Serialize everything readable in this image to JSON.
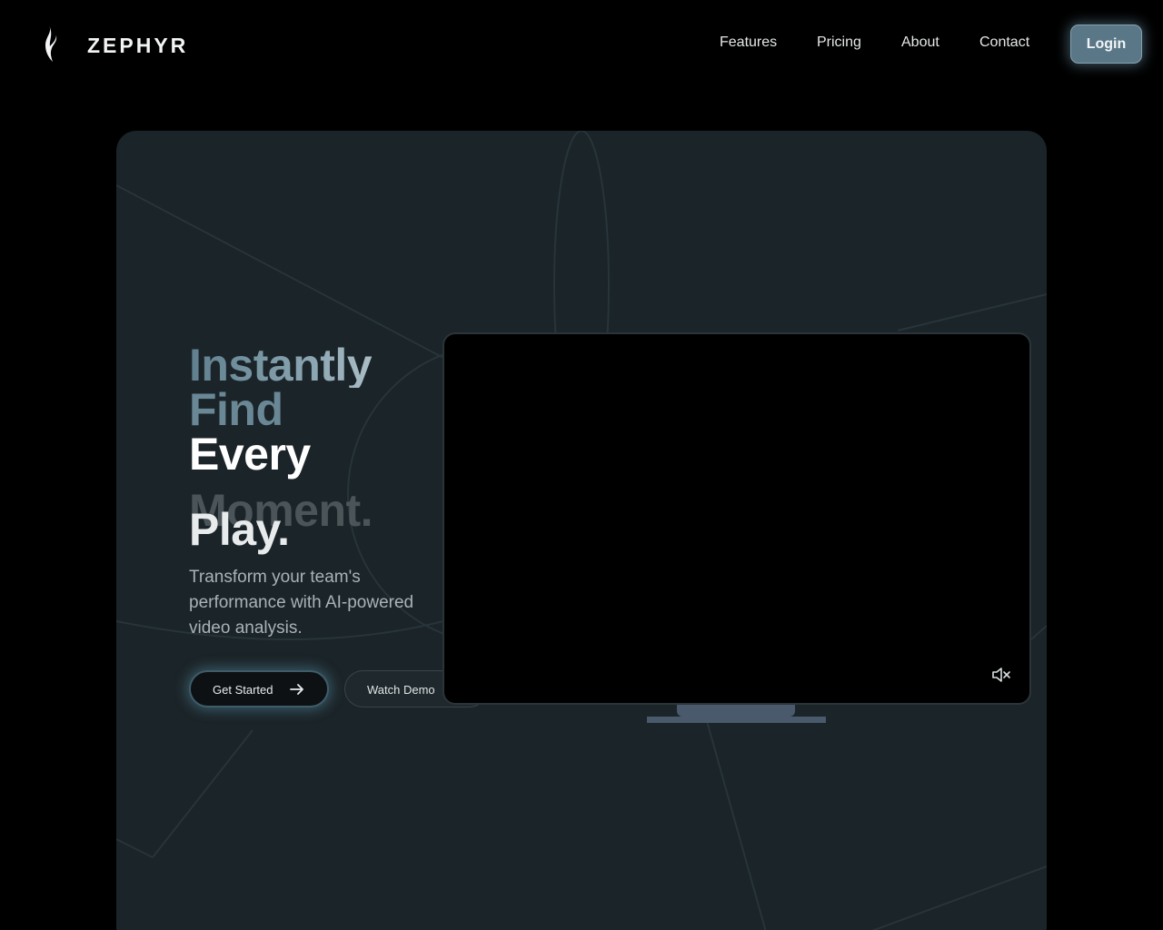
{
  "nav": {
    "brand": "ZEPHYR",
    "logo_icon": "flame-icon",
    "links": [
      "Features",
      "Pricing",
      "About",
      "Contact"
    ],
    "login_label": "Login"
  },
  "hero": {
    "headline": [
      "Instantly",
      "Find",
      "Every"
    ],
    "rotating_word_outgoing": "Moment.",
    "rotating_word_incoming": "Play.",
    "subtitle": "Transform your team's performance with AI-powered video analysis.",
    "primary_cta": "Get Started",
    "secondary_cta": "Watch Demo",
    "primary_cta_icon": "arrow-right-icon",
    "secondary_cta_icon": "play-icon"
  },
  "video": {
    "mute_icon": "volume-muted-icon"
  },
  "colors": {
    "page_bg": "#000000",
    "card_bg": "#1b2428",
    "accent": "#5a7787",
    "stand": "#4a596c"
  }
}
